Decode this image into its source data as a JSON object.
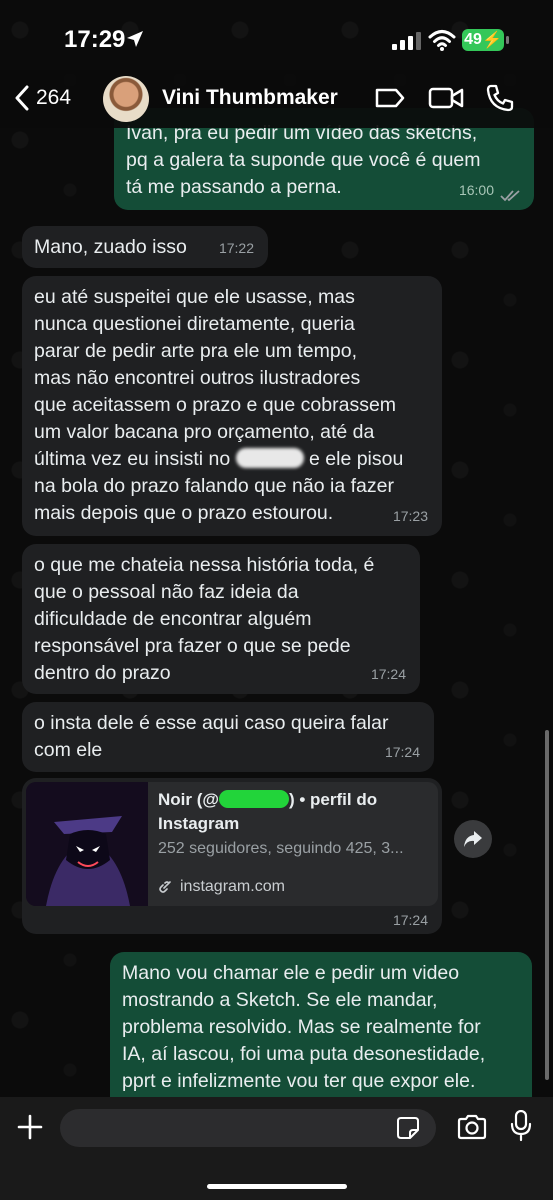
{
  "status_bar": {
    "time": "17:29",
    "battery": "49"
  },
  "header": {
    "back_count": "264",
    "contact_name": "Vini Thumbmaker"
  },
  "messages": [
    {
      "dir": "out",
      "text": "Ivan, pra eu pedir um vídeo das sketchs,\npq a galera ta suponde que você é quem\ntá me passando a perna.",
      "time": "16:00"
    },
    {
      "dir": "in",
      "text": "Mano, zuado isso",
      "time": "17:22"
    },
    {
      "dir": "in",
      "text_before_redaction": "eu até suspeitei que ele usasse, mas\nnunca questionei diretamente, queria\nparar de pedir arte pra ele um tempo,\nmas não encontrei outros ilustradores\nque aceitassem o prazo e que cobrassem\num valor bacana pro orçamento, até da\núltima vez eu insisti no ",
      "text_after_redaction": " e ele pisou\nna bola do prazo falando que não ia fazer\nmais depois que o prazo estourou.",
      "time": "17:23"
    },
    {
      "dir": "in",
      "text": "o que me chateia nessa história toda, é\nque o pessoal não faz ideia da\ndificuldade de encontrar alguém\nresponsável pra fazer o que se pede\ndentro do prazo",
      "time": "17:24"
    },
    {
      "dir": "in",
      "text": "o insta dele é esse aqui caso queira falar\ncom ele",
      "time": "17:24"
    },
    {
      "dir": "out",
      "text": "Mano vou chamar ele e pedir um video\nmostrando a Sketch. Se ele mandar,\nproblema resolvido. Mas se realmente for\nIA, aí lascou, foi uma puta desonestidade,\npprt e infelizmente vou ter que expor ele."
    }
  ],
  "link_preview": {
    "title_start": "Noir (@",
    "title_end": ") • perfil do\nInstagram",
    "description": "252 seguidores, seguindo 425, 3...",
    "domain": "instagram.com",
    "time": "17:24"
  },
  "composer": {
    "placeholder": ""
  },
  "colors": {
    "incoming": "#1f2022",
    "outgoing": "#144d37",
    "accent_green": "#34c759"
  },
  "icons": [
    "location-arrow-icon",
    "signal-icon",
    "wifi-icon",
    "chevron-left-icon",
    "label-icon",
    "video-camera-icon",
    "phone-icon",
    "link-icon",
    "forward-icon",
    "plus-icon",
    "sticker-icon",
    "camera-icon",
    "microphone-icon",
    "double-check-icon"
  ]
}
